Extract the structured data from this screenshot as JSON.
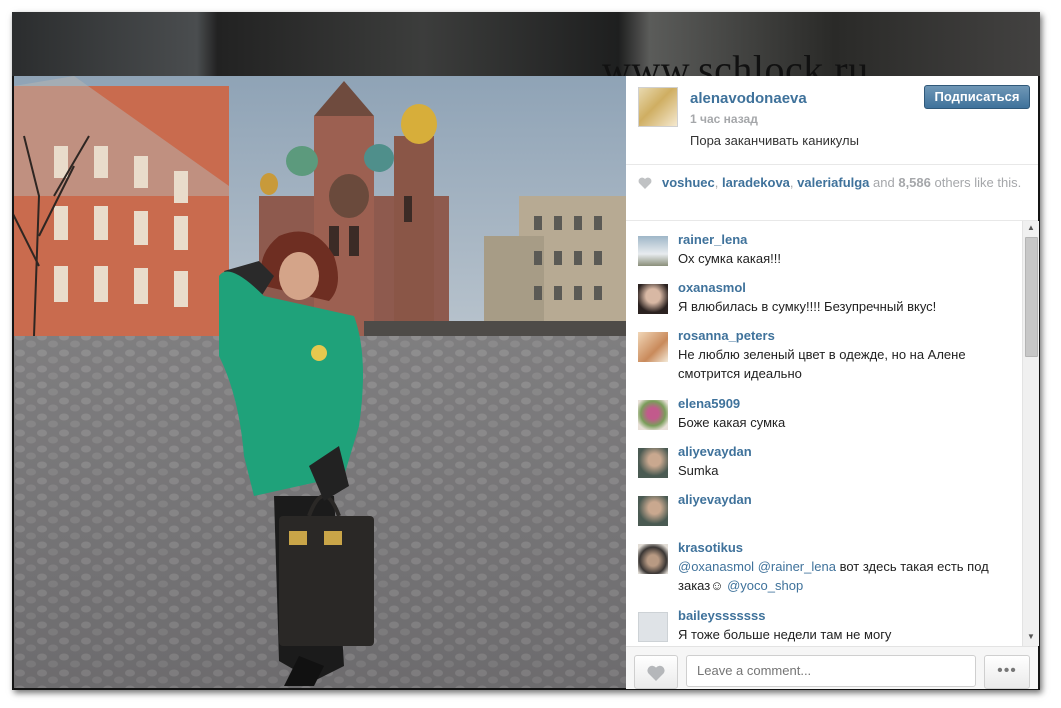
{
  "watermark": "www.schlock.ru",
  "post": {
    "owner": "alenavodonaeva",
    "time": "1 час назад",
    "caption": "Пора заканчивать каникулы ",
    "follow_label": "Подписаться"
  },
  "likes": {
    "users": [
      "voshuec",
      "laradekova",
      "valeriafulga"
    ],
    "sep1": ", ",
    "sep2": ", ",
    "and": " and ",
    "count": "8,586",
    "suffix": " others like this."
  },
  "comments": [
    {
      "user": "rainer_lena",
      "text": "Ох сумка какая!!!"
    },
    {
      "user": "oxanasmol",
      "text": "Я влюбилась в сумку!!!!   Безупречный вкус!"
    },
    {
      "user": "rosanna_peters",
      "text": "Не люблю зеленый цвет в одежде, но на Алене смотрится идеально"
    },
    {
      "user": "elena5909",
      "text": "Боже какая сумка"
    },
    {
      "user": "aliyevaydan",
      "text": "Sumka"
    },
    {
      "user": "aliyevaydan",
      "text": ""
    },
    {
      "user": "krasotikus",
      "mention1": "@oxanasmol",
      "mention2": "@rainer_lena",
      "text": " вот здесь такая есть под заказ☺ ",
      "mention3": "@yoco_shop"
    },
    {
      "user": "baileysssssss",
      "text": "Я тоже больше недели там не могу"
    }
  ],
  "footer": {
    "comment_placeholder": "Leave a comment...",
    "more_label": "•••"
  },
  "colors": {
    "link": "#3f729b",
    "follow_button": "#3f729b",
    "muted": "#a5a7aa"
  },
  "icons": {
    "like": "heart-icon",
    "more": "ellipsis-icon",
    "scroll_up": "arrow-up-icon",
    "scroll_down": "arrow-down-icon"
  }
}
